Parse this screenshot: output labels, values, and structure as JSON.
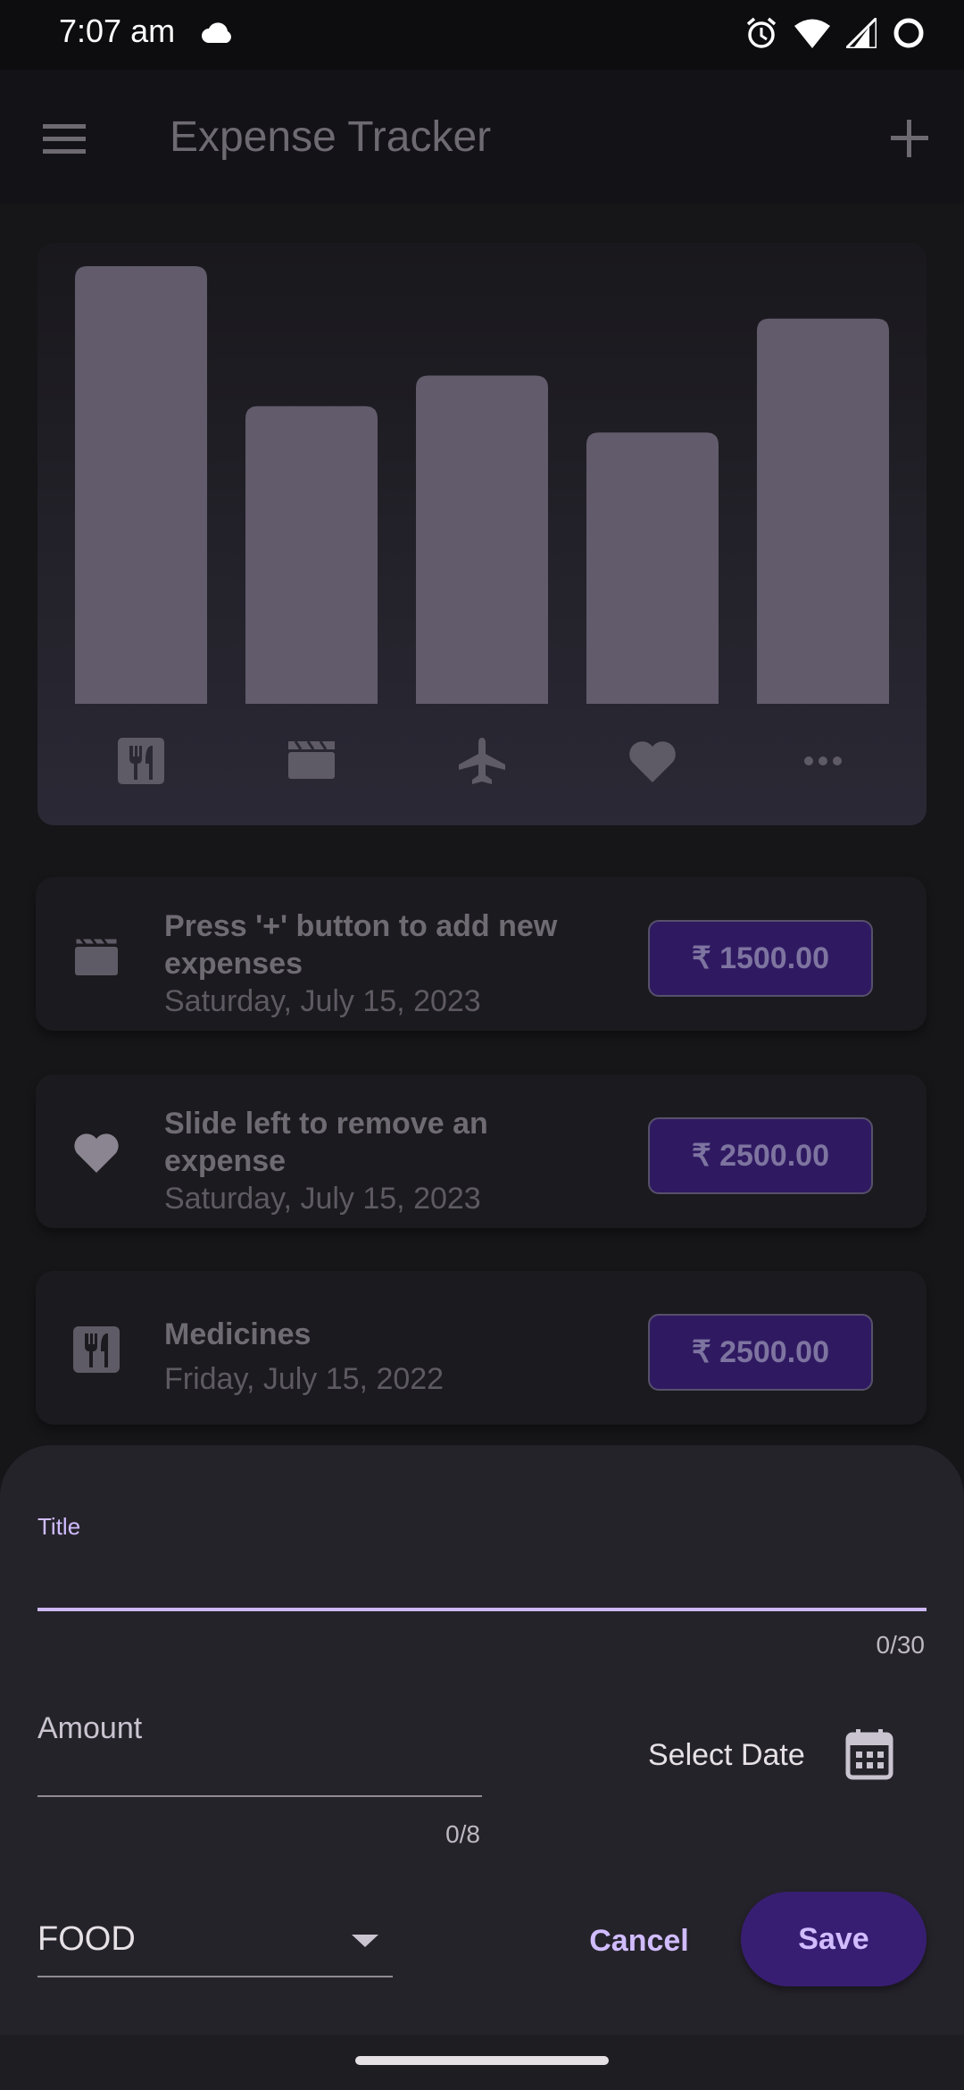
{
  "status_bar": {
    "time": "7:07 am"
  },
  "app_bar": {
    "title": "Expense Tracker",
    "menu_icon": "menu-icon",
    "add_icon": "plus-icon"
  },
  "chart_data": {
    "type": "bar",
    "categories": [
      "food",
      "leisure",
      "travel",
      "health",
      "other"
    ],
    "category_icons": [
      "fork-knife-icon",
      "clapperboard-icon",
      "airplane-icon",
      "heart-icon",
      "more-horiz-icon"
    ],
    "values": [
      1.0,
      0.68,
      0.75,
      0.62,
      0.88
    ],
    "ylim": [
      0,
      1
    ],
    "bar_color": "#625b6b"
  },
  "expenses": [
    {
      "title": "Press '+' button to add new expenses",
      "date": "Saturday, July 15, 2023",
      "amount": "₹ 1500.00",
      "icon": "clapperboard-icon"
    },
    {
      "title": "Slide left to remove an expense",
      "date": "Saturday, July 15, 2023",
      "amount": "₹ 2500.00",
      "icon": "heart-icon"
    },
    {
      "title": "Medicines",
      "date": "Friday, July 15, 2022",
      "amount": "₹ 2500.00",
      "icon": "fork-knife-icon"
    }
  ],
  "form": {
    "title_label": "Title",
    "title_value": "",
    "title_counter": "0/30",
    "amount_label": "Amount",
    "amount_value": "",
    "amount_counter": "0/8",
    "select_date_label": "Select Date",
    "category_value": "FOOD",
    "cancel_label": "Cancel",
    "save_label": "Save"
  },
  "colors": {
    "accent": "#d0bcff",
    "save_bg": "#381e72",
    "amount_chip_bg": "#2f1a62"
  }
}
